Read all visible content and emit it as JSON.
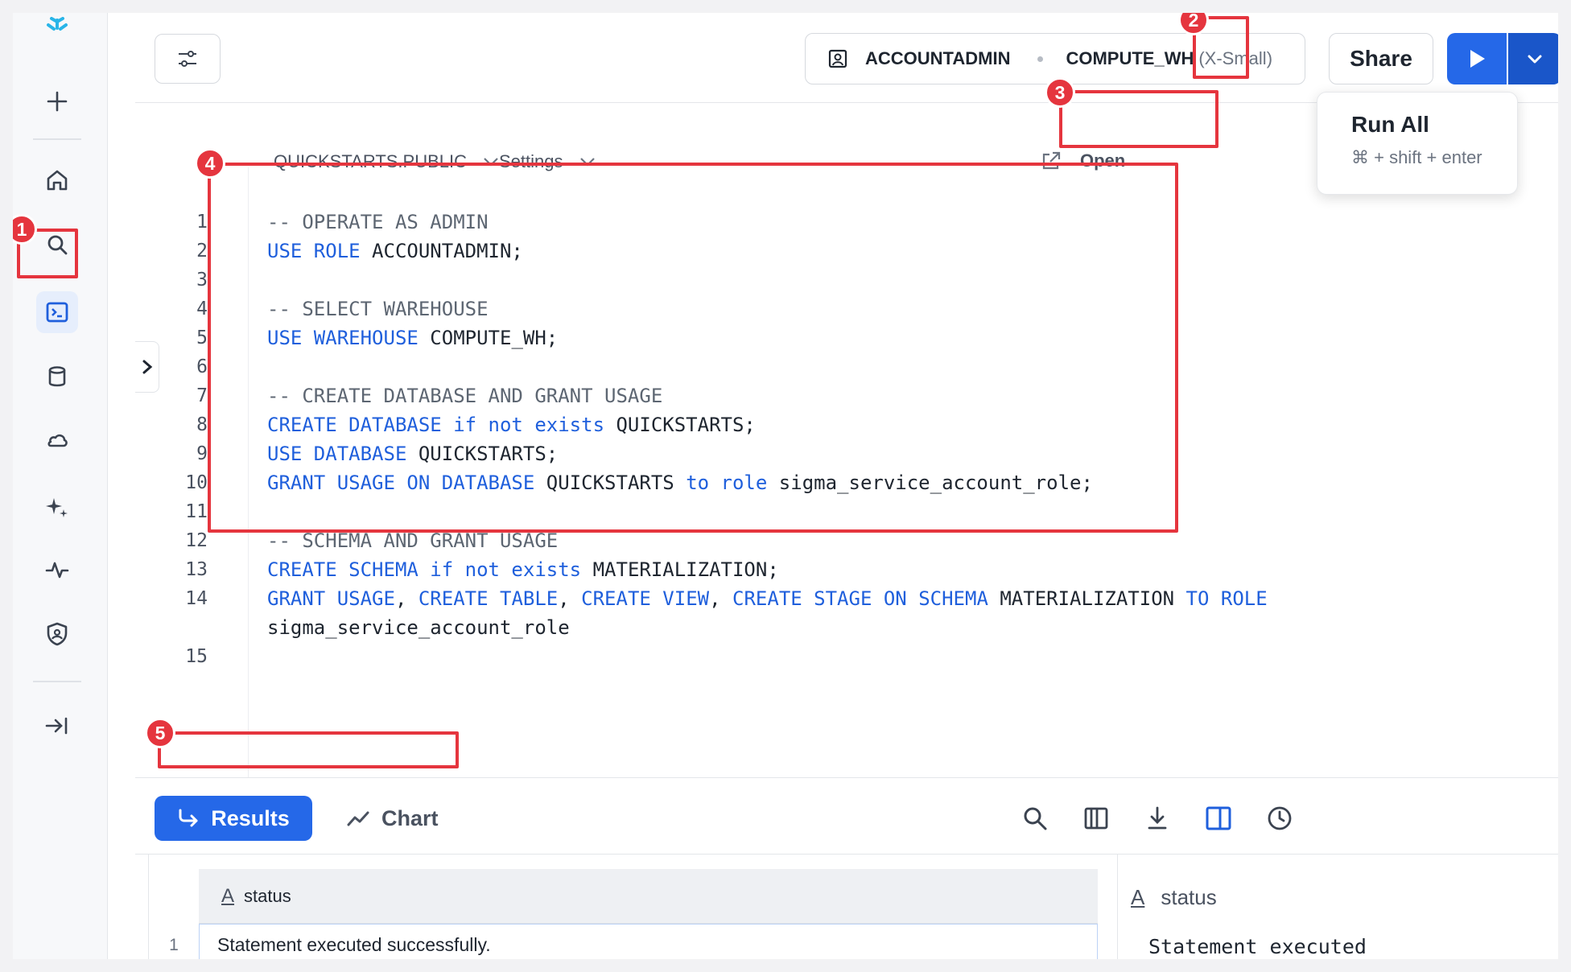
{
  "toolbar": {
    "role": "ACCOUNTADMIN",
    "warehouse": "COMPUTE_WH",
    "warehouse_size": "(X-Small)",
    "share_label": "Share"
  },
  "editor": {
    "database": "QUICKSTARTS.PUBLIC",
    "settings_label": "Settings",
    "open_label": "Open",
    "line_numbers": [
      "1",
      "2",
      "3",
      "4",
      "5",
      "6",
      "7",
      "8",
      "9",
      "10",
      "11",
      "12",
      "13",
      "14",
      "",
      "15"
    ],
    "lines": [
      [
        {
          "t": "-- OPERATE AS ADMIN",
          "c": "cm"
        }
      ],
      [
        {
          "t": "USE ROLE",
          "c": "kw"
        },
        {
          "t": " ACCOUNTADMIN;",
          "c": ""
        }
      ],
      [],
      [
        {
          "t": "-- SELECT WAREHOUSE",
          "c": "cm"
        }
      ],
      [
        {
          "t": "USE WAREHOUSE",
          "c": "kw"
        },
        {
          "t": " COMPUTE_WH;",
          "c": ""
        }
      ],
      [],
      [
        {
          "t": "-- CREATE DATABASE AND GRANT USAGE",
          "c": "cm"
        }
      ],
      [
        {
          "t": "CREATE DATABASE if not exists",
          "c": "kw"
        },
        {
          "t": " QUICKSTARTS;",
          "c": ""
        }
      ],
      [
        {
          "t": "USE DATABASE",
          "c": "kw"
        },
        {
          "t": " QUICKSTARTS;",
          "c": ""
        }
      ],
      [
        {
          "t": "GRANT USAGE ON DATABASE",
          "c": "kw"
        },
        {
          "t": " QUICKSTARTS ",
          "c": ""
        },
        {
          "t": "to role",
          "c": "kw"
        },
        {
          "t": " sigma_service_account_role;",
          "c": ""
        }
      ],
      [],
      [
        {
          "t": "-- SCHEMA AND GRANT USAGE",
          "c": "cm"
        }
      ],
      [
        {
          "t": "CREATE SCHEMA if not exists",
          "c": "kw"
        },
        {
          "t": " MATERIALIZATION;",
          "c": ""
        }
      ],
      [
        {
          "t": "GRANT USAGE",
          "c": "kw"
        },
        {
          "t": ", ",
          "c": ""
        },
        {
          "t": "CREATE TABLE",
          "c": "kw"
        },
        {
          "t": ", ",
          "c": ""
        },
        {
          "t": "CREATE VIEW",
          "c": "kw"
        },
        {
          "t": ", ",
          "c": ""
        },
        {
          "t": "CREATE STAGE ON SCHEMA",
          "c": "kw"
        },
        {
          "t": " MATERIALIZATION ",
          "c": ""
        },
        {
          "t": "TO ROLE",
          "c": "kw"
        }
      ],
      [
        {
          "t": "sigma_service_account_role",
          "c": ""
        }
      ],
      []
    ]
  },
  "run_menu": {
    "title": "Run All",
    "shortcut": "⌘ + shift + enter"
  },
  "results": {
    "results_tab": "Results",
    "chart_tab": "Chart",
    "column": "status",
    "row_number": "1",
    "cell_value": "Statement executed successfully.",
    "inspector_title": "status",
    "inspector_value": "Statement executed"
  },
  "annotations": [
    "1",
    "2",
    "3",
    "4",
    "5"
  ],
  "colors": {
    "accent": "#2568e8",
    "keyword": "#1f5fdc",
    "annotation": "#e5353e"
  }
}
